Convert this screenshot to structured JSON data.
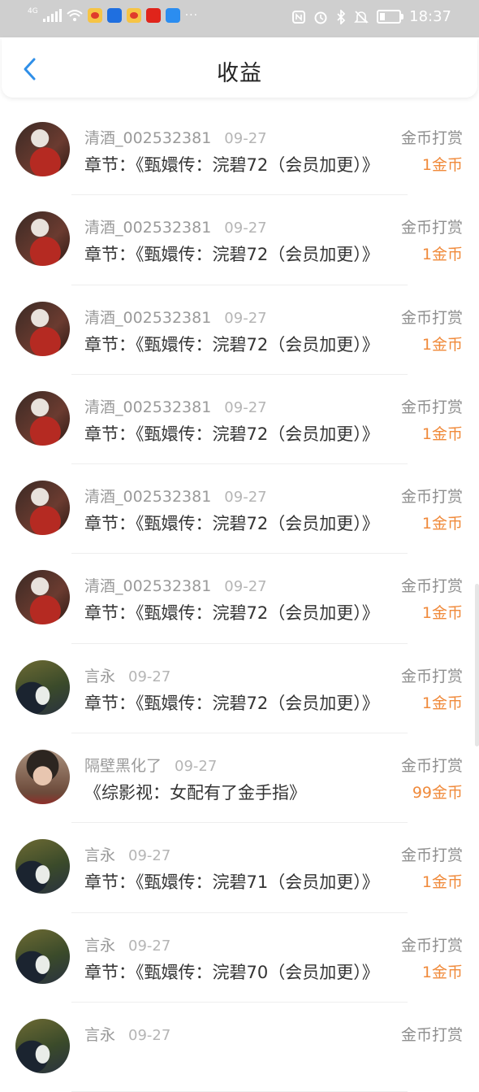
{
  "status_bar": {
    "network": "4G",
    "time": "18:37"
  },
  "header": {
    "title": "收益"
  },
  "records": [
    {
      "avatar": "girl",
      "name": "清酒_002532381",
      "date": "09-27",
      "type": "金币打赏",
      "desc": "章节：《甄嬛传：浣碧72（会员加更）》",
      "amount": "1金币"
    },
    {
      "avatar": "girl",
      "name": "清酒_002532381",
      "date": "09-27",
      "type": "金币打赏",
      "desc": "章节：《甄嬛传：浣碧72（会员加更）》",
      "amount": "1金币"
    },
    {
      "avatar": "girl",
      "name": "清酒_002532381",
      "date": "09-27",
      "type": "金币打赏",
      "desc": "章节：《甄嬛传：浣碧72（会员加更）》",
      "amount": "1金币"
    },
    {
      "avatar": "girl",
      "name": "清酒_002532381",
      "date": "09-27",
      "type": "金币打赏",
      "desc": "章节：《甄嬛传：浣碧72（会员加更）》",
      "amount": "1金币"
    },
    {
      "avatar": "girl",
      "name": "清酒_002532381",
      "date": "09-27",
      "type": "金币打赏",
      "desc": "章节：《甄嬛传：浣碧72（会员加更）》",
      "amount": "1金币"
    },
    {
      "avatar": "girl",
      "name": "清酒_002532381",
      "date": "09-27",
      "type": "金币打赏",
      "desc": "章节：《甄嬛传：浣碧72（会员加更）》",
      "amount": "1金币"
    },
    {
      "avatar": "cat",
      "name": "言永",
      "date": "09-27",
      "type": "金币打赏",
      "desc": "章节：《甄嬛传：浣碧72（会员加更）》",
      "amount": "1金币"
    },
    {
      "avatar": "boy",
      "name": "隔壁黑化了",
      "date": "09-27",
      "type": "金币打赏",
      "desc": "《综影视：女配有了金手指》",
      "amount": "99金币"
    },
    {
      "avatar": "cat",
      "name": "言永",
      "date": "09-27",
      "type": "金币打赏",
      "desc": "章节：《甄嬛传：浣碧71（会员加更）》",
      "amount": "1金币"
    },
    {
      "avatar": "cat",
      "name": "言永",
      "date": "09-27",
      "type": "金币打赏",
      "desc": "章节：《甄嬛传：浣碧70（会员加更）》",
      "amount": "1金币"
    },
    {
      "avatar": "cat",
      "name": "言永",
      "date": "09-27",
      "type": "金币打赏",
      "desc": "",
      "amount": ""
    }
  ]
}
